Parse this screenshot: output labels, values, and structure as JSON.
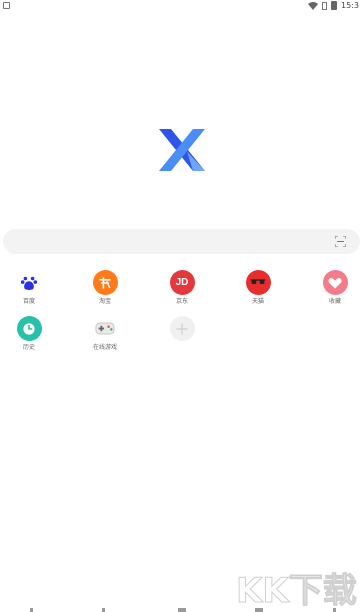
{
  "status_bar": {
    "time": "15:3",
    "icons": [
      "notification-icon",
      "wifi-icon",
      "sim-icon",
      "battery-icon"
    ]
  },
  "logo": {
    "name": "x-browser-logo",
    "colors": [
      "#2d55e8",
      "#4a8df7",
      "#7fb8ff"
    ]
  },
  "search": {
    "placeholder": "",
    "scan_icon": "scan-icon"
  },
  "shortcuts": [
    {
      "label": "百度",
      "icon": "baidu-paw-icon",
      "color": "#ffffff"
    },
    {
      "label": "淘宝",
      "icon": "taobao-icon",
      "color": "#ff7a1a"
    },
    {
      "label": "京东",
      "icon": "jd-icon",
      "color": "#e4393c",
      "glyph": "JD"
    },
    {
      "label": "天猫",
      "icon": "tmall-icon",
      "color": "#e82d2d"
    },
    {
      "label": "收藏",
      "icon": "favorites-icon",
      "color": "#f37b8a"
    },
    {
      "label": "历史",
      "icon": "history-icon",
      "color": "#27c0a8"
    },
    {
      "label": "在线游戏",
      "icon": "gamepad-icon",
      "color": "#ffffff"
    },
    {
      "label": "",
      "icon": "add-icon",
      "color": "#eeeeee"
    }
  ],
  "watermark": {
    "text": "KK下载"
  }
}
